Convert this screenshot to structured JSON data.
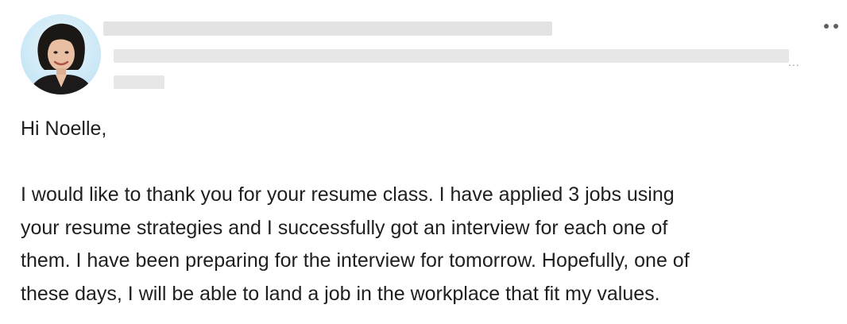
{
  "post": {
    "author_avatar_icon": "person-photo-avatar",
    "more_icon": "more-horizontal-icon",
    "truncation_text": "...",
    "greeting": "Hi Noelle,",
    "body_lines": [
      "I would like to thank you for your resume class. I have applied 3 jobs using",
      "your resume strategies and I successfully got an interview for each one of",
      "them. I have been preparing for the interview for tomorrow. Hopefully, one of",
      "these days, I will be able to land a job in the workplace that fit my values."
    ]
  },
  "colors": {
    "text": "#1f1f1f",
    "redaction": "#e6e6e6",
    "avatar_bg": "#cfe9f7"
  }
}
